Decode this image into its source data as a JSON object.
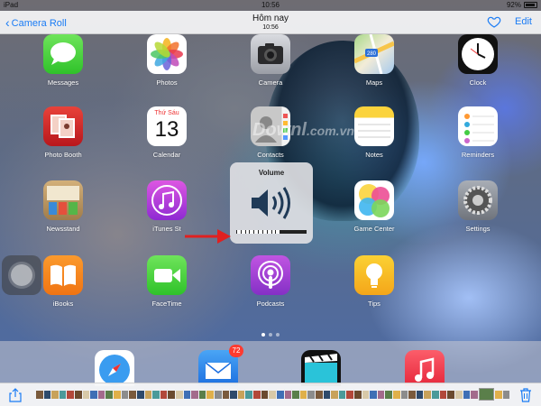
{
  "status_bar": {
    "device": "iPad",
    "time": "10:56",
    "battery": "92%"
  },
  "nav": {
    "back_label": "Camera Roll",
    "title": "Hôm nay",
    "subtitle": "10:56",
    "edit_label": "Edit",
    "heart_icon": "heart-icon"
  },
  "apps": [
    {
      "label": "Messages",
      "icon": "messages-icon"
    },
    {
      "label": "Photos",
      "icon": "photos-icon"
    },
    {
      "label": "Camera",
      "icon": "camera-icon"
    },
    {
      "label": "Maps",
      "icon": "maps-icon"
    },
    {
      "label": "Clock",
      "icon": "clock-icon"
    },
    {
      "label": "Photo Booth",
      "icon": "photo-booth-icon"
    },
    {
      "label": "Calendar",
      "icon": "calendar-icon",
      "day": "Thứ Sáu",
      "date": "13"
    },
    {
      "label": "Contacts",
      "icon": "contacts-icon"
    },
    {
      "label": "Notes",
      "icon": "notes-icon"
    },
    {
      "label": "Reminders",
      "icon": "reminders-icon"
    },
    {
      "label": "Newsstand",
      "icon": "newsstand-icon"
    },
    {
      "label": "iTunes St",
      "icon": "itunes-store-icon"
    },
    {
      "label": "Game Center",
      "icon": "game-center-icon"
    },
    {
      "label": "Settings",
      "icon": "settings-icon"
    },
    {
      "label": "iBooks",
      "icon": "ibooks-icon"
    },
    {
      "label": "FaceTime",
      "icon": "facetime-icon"
    },
    {
      "label": "Podcasts",
      "icon": "podcasts-icon"
    },
    {
      "label": "Tips",
      "icon": "tips-icon"
    }
  ],
  "maps_badge": "280",
  "volume": {
    "title": "Volume",
    "level": 0.62,
    "icon": "speaker-icon"
  },
  "dock": {
    "apps": [
      {
        "icon": "safari-icon"
      },
      {
        "icon": "mail-icon",
        "badge": "72"
      },
      {
        "icon": "videos-icon"
      },
      {
        "icon": "music-icon"
      }
    ]
  },
  "watermark": {
    "text": "Downl",
    "tail": ".com.vn"
  },
  "toolbar": {
    "share_icon": "share-icon",
    "trash_icon": "trash-icon",
    "thumbnail_count": 60
  },
  "colors": {
    "accent": "#1a7cf5",
    "arrow": "#e02020",
    "badge": "#ff3b30"
  }
}
